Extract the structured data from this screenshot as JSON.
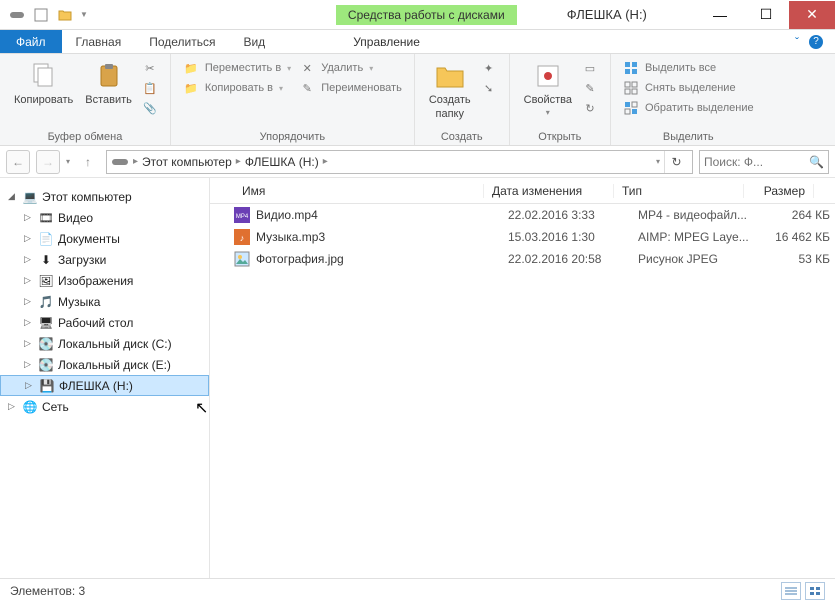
{
  "titlebar": {
    "context_tab": "Средства работы с дисками",
    "title": "ФЛЕШКА (H:)"
  },
  "tabs": {
    "file": "Файл",
    "home": "Главная",
    "share": "Поделиться",
    "view": "Вид",
    "manage": "Управление"
  },
  "ribbon": {
    "clipboard": {
      "copy": "Копировать",
      "paste": "Вставить",
      "label": "Буфер обмена"
    },
    "organize": {
      "move_to": "Переместить в",
      "copy_to": "Копировать в",
      "delete": "Удалить",
      "rename": "Переименовать",
      "label": "Упорядочить"
    },
    "new": {
      "new_folder_l1": "Создать",
      "new_folder_l2": "папку",
      "label": "Создать"
    },
    "open": {
      "properties": "Свойства",
      "label": "Открыть"
    },
    "select": {
      "select_all": "Выделить все",
      "select_none": "Снять выделение",
      "invert": "Обратить выделение",
      "label": "Выделить"
    }
  },
  "address": {
    "seg1": "Этот компьютер",
    "seg2": "ФЛЕШКА (H:)"
  },
  "search": {
    "placeholder": "Поиск: Ф..."
  },
  "tree": {
    "root": "Этот компьютер",
    "items": [
      {
        "label": "Видео"
      },
      {
        "label": "Документы"
      },
      {
        "label": "Загрузки"
      },
      {
        "label": "Изображения"
      },
      {
        "label": "Музыка"
      },
      {
        "label": "Рабочий стол"
      },
      {
        "label": "Локальный диск (C:)"
      },
      {
        "label": "Локальный диск (E:)"
      },
      {
        "label": "ФЛЕШКА (H:)"
      }
    ],
    "network": "Сеть"
  },
  "columns": {
    "name": "Имя",
    "date": "Дата изменения",
    "type": "Тип",
    "size": "Размер"
  },
  "files": [
    {
      "name": "Видио.mp4",
      "date": "22.02.2016 3:33",
      "type": "MP4 - видеофайл...",
      "size": "264 КБ"
    },
    {
      "name": "Музыка.mp3",
      "date": "15.03.2016 1:30",
      "type": "AIMP: MPEG Laye...",
      "size": "16 462 КБ"
    },
    {
      "name": "Фотография.jpg",
      "date": "22.02.2016 20:58",
      "type": "Рисунок JPEG",
      "size": "53 КБ"
    }
  ],
  "status": {
    "items": "Элементов: 3"
  }
}
